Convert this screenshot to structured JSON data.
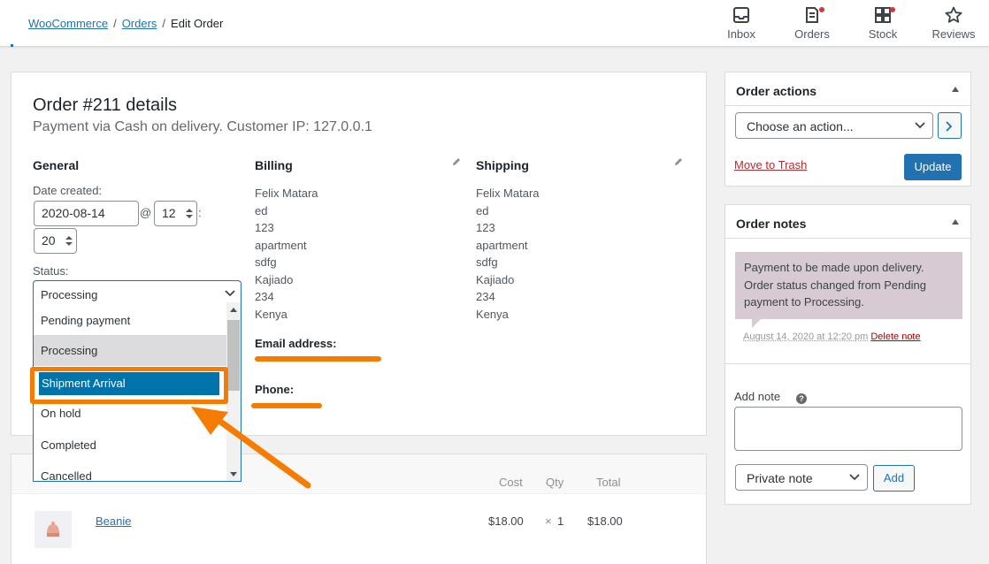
{
  "breadcrumb": {
    "woocommerce": "WooCommerce",
    "orders": "Orders",
    "current": "Edit Order",
    "separator": "/"
  },
  "topnav": [
    {
      "label": "Inbox",
      "icon": "inbox-icon"
    },
    {
      "label": "Orders",
      "icon": "orders-icon"
    },
    {
      "label": "Stock",
      "icon": "stock-icon"
    },
    {
      "label": "Reviews",
      "icon": "star-icon"
    }
  ],
  "order": {
    "title": "Order #211 details",
    "subtitle": "Payment via Cash on delivery. Customer IP: 127.0.0.1"
  },
  "general": {
    "heading": "General",
    "date_label": "Date created:",
    "date_value": "2020-08-14",
    "at": "@",
    "hour": "12",
    "colon": ":",
    "minute": "20",
    "status_label": "Status:",
    "status_value": "Processing",
    "options": [
      "Pending payment",
      "Processing",
      "Shipment Arrival",
      "On hold",
      "Completed",
      "Cancelled"
    ],
    "hovered_option": "Processing",
    "selected_option": "Shipment Arrival"
  },
  "billing": {
    "heading": "Billing",
    "lines": [
      "Felix Matara",
      "ed",
      "123",
      "apartment",
      "sdfg",
      "Kajiado",
      "234",
      "Kenya"
    ],
    "email_label": "Email address:",
    "phone_label": "Phone:"
  },
  "shipping": {
    "heading": "Shipping",
    "lines": [
      "Felix Matara",
      "ed",
      "123",
      "apartment",
      "sdfg",
      "Kajiado",
      "234",
      "Kenya"
    ]
  },
  "items": {
    "headers": {
      "cost": "Cost",
      "qty": "Qty",
      "total": "Total"
    },
    "rows": [
      {
        "name": "Beanie",
        "cost": "$18.00",
        "qty_x": "×",
        "qty": "1",
        "total": "$18.00"
      }
    ]
  },
  "order_actions": {
    "title": "Order actions",
    "select_value": "Choose an action...",
    "trash": "Move to Trash",
    "update": "Update"
  },
  "order_notes": {
    "title": "Order notes",
    "note_text": "Payment to be made upon delivery. Order status changed from Pending payment to Processing.",
    "note_date": "August 14, 2020 at 12:20 pm",
    "delete": "Delete note",
    "add_label": "Add note",
    "help": "?",
    "note_type": "Private note",
    "add_button": "Add"
  },
  "colors": {
    "accent": "#2271b1",
    "highlight": "#f57c00",
    "selected": "#0073aa",
    "note_bg": "#d7cad2"
  }
}
